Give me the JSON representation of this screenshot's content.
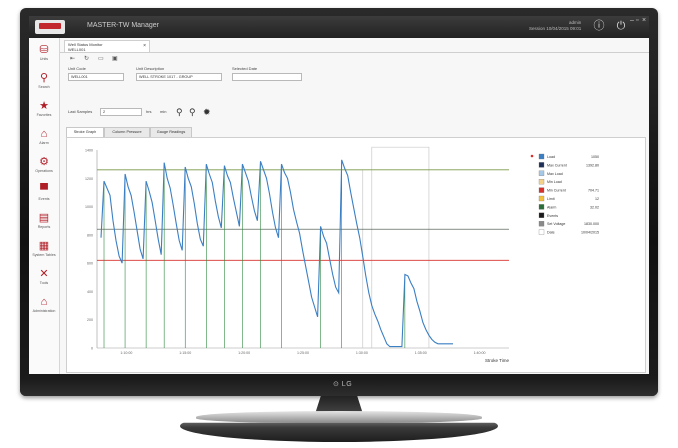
{
  "app": {
    "title": "MASTER-TW Manager",
    "user_line1": "admin",
    "user_line2": "Session 10/04/2015 09:01"
  },
  "sidebar": {
    "items": [
      {
        "label": "Units",
        "icon": "database-icon"
      },
      {
        "label": "Search",
        "icon": "search-icon"
      },
      {
        "label": "Favorites",
        "icon": "star-icon"
      },
      {
        "label": "Alarm",
        "icon": "alarm-icon"
      },
      {
        "label": "Operations",
        "icon": "gears-icon"
      },
      {
        "label": "Events",
        "icon": "chat-icon"
      },
      {
        "label": "Reports",
        "icon": "report-icon"
      },
      {
        "label": "System Tables",
        "icon": "table-icon"
      },
      {
        "label": "Tools",
        "icon": "tools-icon"
      },
      {
        "label": "Administration",
        "icon": "admin-icon"
      }
    ]
  },
  "document_tab": {
    "line1": "Well Status Monitor",
    "line2": "WELL001",
    "close": "×"
  },
  "form": {
    "unit_code_label": "Unit Code",
    "unit_code_value": "WELL001",
    "unit_desc_label": "Unit Description",
    "unit_desc_value": "WELL STROKE 1017 - GROUP",
    "sel_date_label": "Selected Date",
    "sel_date_value": "",
    "last_label": "Last Samples",
    "last_value": "2",
    "unit_1": "hrs",
    "unit_2": "min"
  },
  "subtabs": [
    "Stroke Graph",
    "Column Pressure",
    "Gauge Readings"
  ],
  "chart_data": {
    "type": "line",
    "xlabel": "Stroke Time",
    "x_ticks": [
      "1:10:00",
      "1:15:00",
      "1:20:00",
      "1:25:00",
      "1:30:00",
      "1:35:00",
      "1:40:00"
    ],
    "y_ticks": [
      "0",
      "200",
      "400",
      "600",
      "800",
      "1000",
      "1200",
      "1400"
    ],
    "ylim": [
      0,
      1400
    ],
    "series": [
      {
        "name": "Load",
        "values": [
          780,
          1180,
          1130,
          1080,
          900,
          760,
          650,
          600,
          1230,
          1140,
          1080,
          960,
          830,
          700,
          630,
          1180,
          1110,
          1030,
          900,
          770,
          660,
          1310,
          1200,
          1130,
          1010,
          880,
          760,
          690,
          1280,
          1200,
          1140,
          1020,
          880,
          770,
          720,
          1300,
          1230,
          1170,
          1040,
          930,
          850,
          1290,
          1220,
          1170,
          1060,
          960,
          860,
          1300,
          1240,
          1180,
          1070,
          970,
          900,
          1320,
          1260,
          1200,
          1090,
          960,
          850,
          780,
          1300,
          1240,
          1200,
          1100,
          980,
          890,
          810,
          690,
          580,
          470,
          360,
          290,
          220,
          860,
          790,
          740,
          630,
          520,
          430,
          390,
          1330,
          1270,
          1220,
          1100,
          990,
          880,
          780,
          650,
          510,
          390,
          300,
          240,
          190,
          130,
          80,
          30,
          10,
          10,
          10,
          10,
          10,
          520,
          510,
          460,
          420,
          330,
          260,
          180,
          130,
          90,
          60,
          40,
          30,
          30,
          30,
          30,
          30,
          30
        ]
      },
      {
        "name": "Max Load",
        "values": [
          1260
        ]
      },
      {
        "name": "Min Load",
        "values": [
          620
        ]
      },
      {
        "name": "Avg",
        "values": [
          840
        ]
      }
    ],
    "legend": [
      {
        "label": "Load",
        "value": "1050"
      },
      {
        "label": "Max Current",
        "value": "1392.80"
      },
      {
        "label": "Max Load",
        "value": ""
      },
      {
        "label": "Min Load",
        "value": ""
      },
      {
        "label": "Min Current",
        "value": "704.71"
      },
      {
        "label": "Limit",
        "value": "12"
      },
      {
        "label": "Alarm",
        "value": "32.02"
      },
      {
        "label": "Events",
        "value": ""
      },
      {
        "label": "Set Voltage",
        "value": "1830.000"
      },
      {
        "label": "Date",
        "value": "10/04/2015"
      }
    ],
    "colors": {
      "load": "#3b7fc4",
      "max": "#7a9a4a",
      "min": "#d9302c",
      "avg": "#3c4a3c",
      "vline": "#2f8a3f",
      "step": "#c9c9c9"
    },
    "grid": false,
    "legend_placement": "right"
  }
}
